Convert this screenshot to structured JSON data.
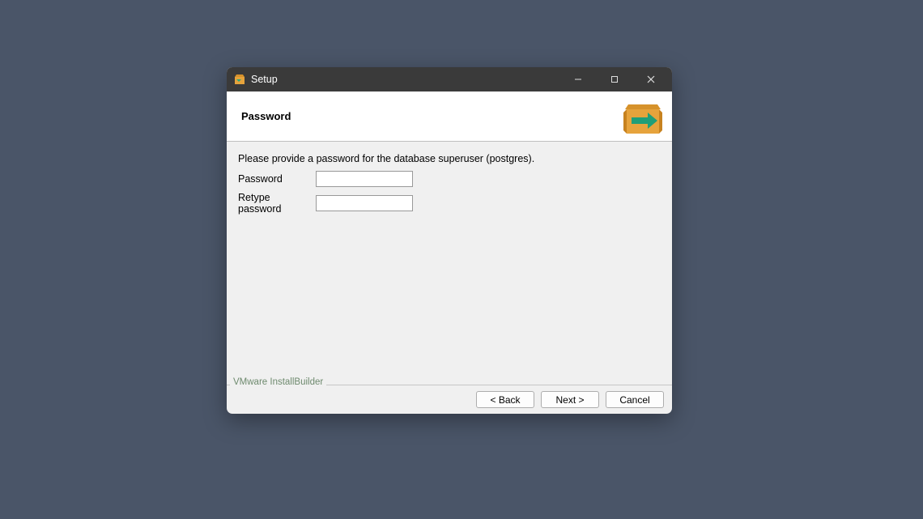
{
  "titlebar": {
    "title": "Setup"
  },
  "header": {
    "page_title": "Password"
  },
  "content": {
    "instruction": "Please provide a password for the database superuser (postgres).",
    "password_label": "Password",
    "retype_label": "Retype password",
    "password_value": "",
    "retype_value": ""
  },
  "footer": {
    "branding": "VMware InstallBuilder",
    "back": "< Back",
    "next": "Next >",
    "cancel": "Cancel"
  }
}
